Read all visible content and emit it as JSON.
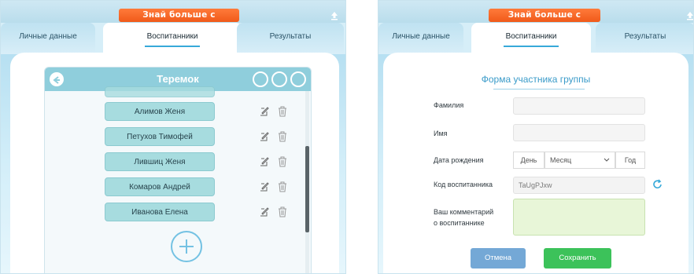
{
  "banner": {
    "text": "Знай больше с Робобориком!"
  },
  "tabs": [
    "Личные данные",
    "Воспитанники",
    "Результаты"
  ],
  "group": {
    "title": "Теремок",
    "students": [
      "Алимов Женя",
      "Петухов Тимофей",
      "Лившиц Женя",
      "Комаров Андрей",
      "Иванова Елена"
    ]
  },
  "form": {
    "title": "Форма участника группы",
    "labels": {
      "surname": "Фамилия",
      "name": "Имя",
      "birth": "Дата рождения",
      "code": "Код воспитанника",
      "comment_line1": "Ваш комментарий",
      "comment_line2": "о воспитаннике"
    },
    "birth": {
      "day": "День",
      "month": "Месяц",
      "year": "Год"
    },
    "code_value": "TaUgPJxw",
    "cancel": "Отмена",
    "save": "Сохранить"
  },
  "colors": {
    "banner": "#f05a1a",
    "accent": "#37a9d9",
    "group_header": "#8fcedc",
    "student_button": "#a7dcdf",
    "cancel_button": "#74a8d6",
    "save_button": "#3cc25a"
  }
}
